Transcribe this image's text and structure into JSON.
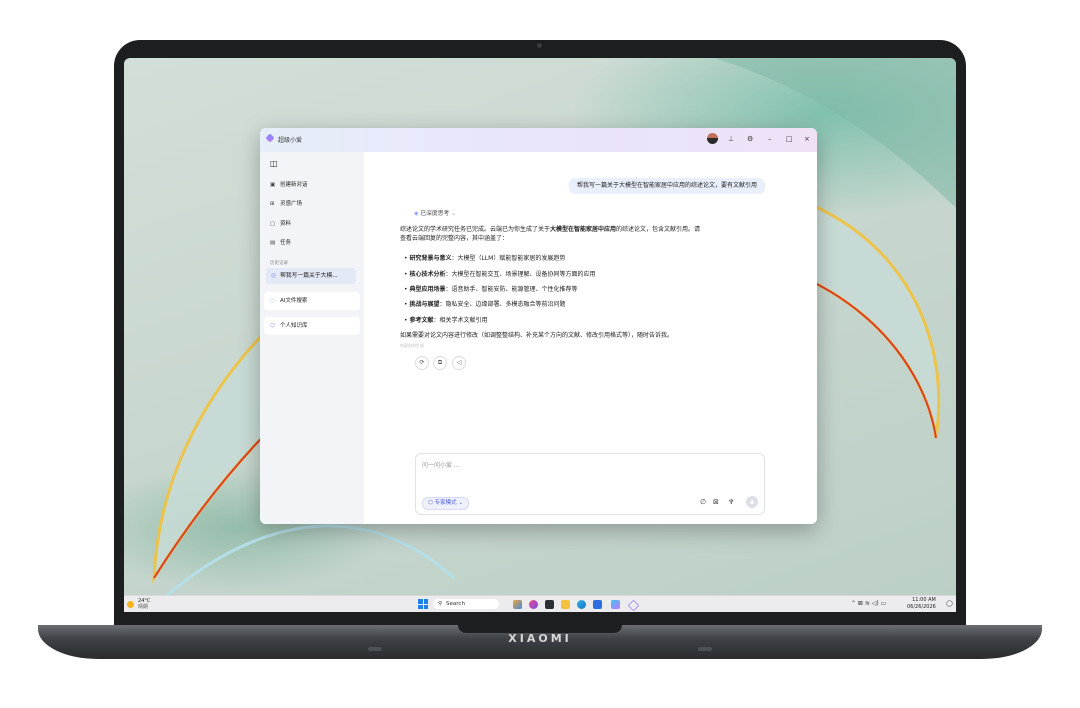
{
  "app": {
    "title": "超级小爱"
  },
  "sidebar": {
    "items": [
      {
        "label": "创建新对话",
        "icon": "chat-plus-icon"
      },
      {
        "label": "灵感广场",
        "icon": "grid-icon"
      },
      {
        "label": "资料",
        "icon": "document-icon"
      },
      {
        "label": "任务",
        "icon": "task-icon"
      }
    ],
    "history_label": "历史记录",
    "history_item": "帮我写一篇关于大模...",
    "search_file": "AI文件搜索",
    "knowledge_base": "个人知识库"
  },
  "chat": {
    "user_message": "帮我写一篇关于大模型在智能家居中应用的综述论文，要有文献引用",
    "thinking": "已深度思考",
    "intro_line1": "综述论文的学术研究任务已完成。云端已为你生成了关于",
    "intro_bold": "大模型在智能家居中应用",
    "intro_line1_end": "的综述论文，包含文献引用。请",
    "intro_line2": "查看云端回复的完整内容，其中涵盖了：",
    "bullets": [
      {
        "title": "研究背景与意义",
        "text": "：大模型（LLM）赋能智能家居的发展趋势"
      },
      {
        "title": "核心技术分析",
        "text": "：大模型在智能交互、场景理解、设备协同等方面的应用"
      },
      {
        "title": "典型应用场景",
        "text": "：语音助手、智能安防、能源管理、个性化推荐等"
      },
      {
        "title": "挑战与展望",
        "text": "：隐私安全、边缘部署、多模态融合等前沿问题"
      },
      {
        "title": "参考文献",
        "text": "：相关学术文献引用"
      }
    ],
    "closing": "如果需要对论文内容进行修改（如调整整结构、补充某个方向的文献、修改引用格式等），随时告诉我。",
    "ai_note": "内容由AI生成"
  },
  "input": {
    "placeholder": "问一问小爱 ...",
    "mode": "专家模式"
  },
  "taskbar": {
    "temperature": "24°C",
    "weather": "晴朗",
    "search": "Search",
    "time": "11:00 AM",
    "date": "06/26/2026"
  },
  "device": {
    "brand": "XIAOMI"
  },
  "colors": {
    "accent": "#5160d8",
    "bubble": "#eaf0fb",
    "taskbar_logo": "#1d82e8"
  }
}
